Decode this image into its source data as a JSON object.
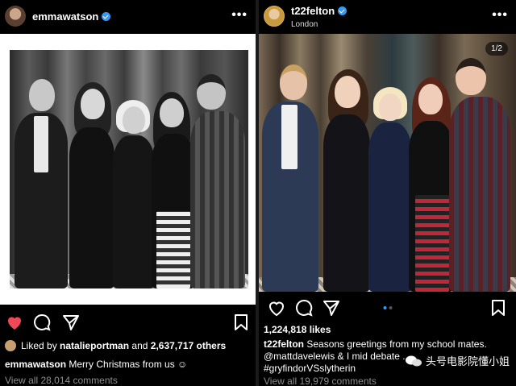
{
  "left_post": {
    "username": "emmawatson",
    "more_label": "•••",
    "liked_by_prefix": "Liked by",
    "liked_by_user": "natalieportman",
    "liked_by_suffix": "and",
    "liked_by_count": "2,637,717 others",
    "caption_user": "emmawatson",
    "caption_text": "Merry Christmas from us ☺",
    "view_comments": "View all 28,014 comments"
  },
  "right_post": {
    "username": "t22felton",
    "location": "London",
    "more_label": "•••",
    "slide_counter": "1/2",
    "likes": "1,224,818 likes",
    "caption_user": "t22felton",
    "caption_line1": "Seasons greetings from my school mates.",
    "caption_line2": "@mattdavelewis & I mid debate ...",
    "caption_line3": "#gryfindorVSslytherin",
    "view_comments": "View all 19,979 comments"
  },
  "watermark": {
    "text": "头号电影院懂小姐"
  },
  "icons": {
    "like_filled": "heart-filled-icon",
    "like": "heart-icon",
    "comment": "comment-icon",
    "share": "send-icon",
    "save": "bookmark-icon",
    "verified": "verified-badge-icon"
  },
  "colors": {
    "like_red": "#ed4956",
    "verified_blue": "#3897f0",
    "muted": "#8e8e8e",
    "background": "#000000"
  }
}
